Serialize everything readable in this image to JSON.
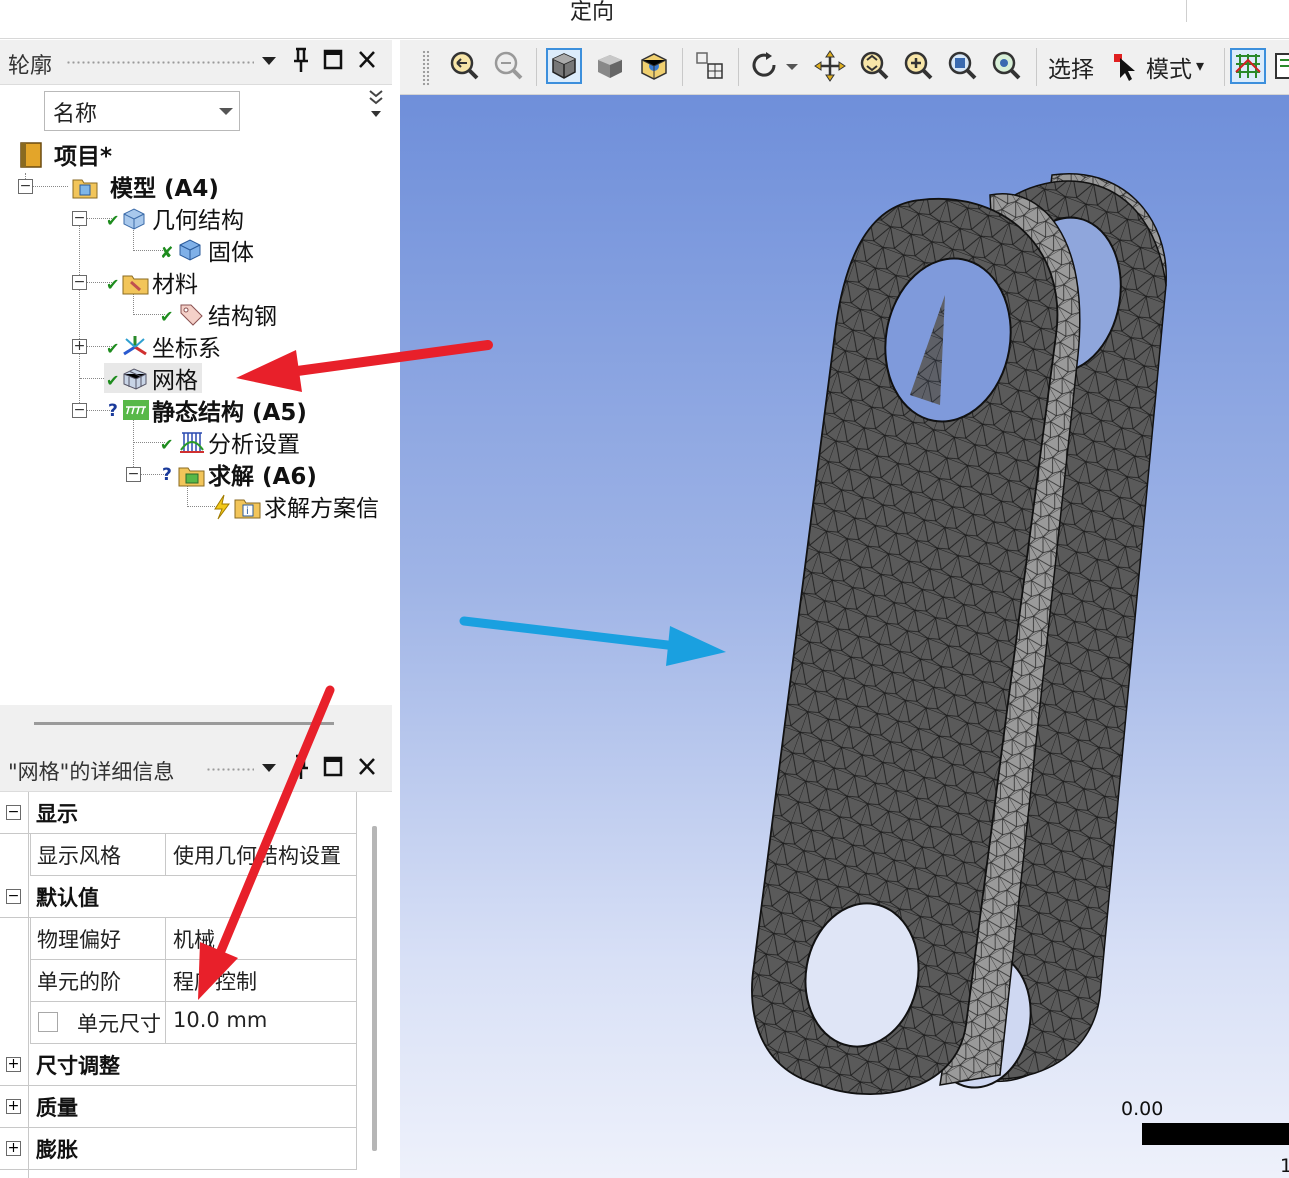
{
  "top_bar": {
    "label": "定向"
  },
  "outline": {
    "title": "轮廓",
    "filter_combo": "名称",
    "tree": {
      "project": "项目*",
      "model": "模型 (A4)",
      "geometry": "几何结构",
      "solid": "固体",
      "materials": "材料",
      "structural_steel": "结构钢",
      "coordinate_systems": "坐标系",
      "mesh": "网格",
      "static_structural": "静态结构 (A5)",
      "analysis_settings": "分析设置",
      "solution": "求解 (A6)",
      "solution_info": "求解方案信"
    }
  },
  "details": {
    "title": "\"网格\"的详细信息",
    "groups": {
      "display": "显示",
      "defaults": "默认值",
      "sizing": "尺寸调整",
      "quality": "质量",
      "inflation": "膨胀"
    },
    "props": {
      "display_style": {
        "name": "显示风格",
        "value": "使用几何结构设置"
      },
      "physics_preference": {
        "name": "物理偏好",
        "value": "机械"
      },
      "element_order": {
        "name": "单元的阶",
        "value": "程序控制"
      },
      "element_size": {
        "name": "单元尺寸",
        "value": "10.0 mm"
      }
    }
  },
  "toolbar": {
    "select_label": "选择",
    "mode_label": "模式",
    "mode_arrow": "▾"
  },
  "viewport": {
    "scale_label": "0.00",
    "scale_end_label": "1"
  },
  "colors": {
    "viewport_top": "#6f8fda",
    "viewport_bottom": "#eef1fb",
    "annotation_red": "#e8202a",
    "annotation_blue": "#1aa0e0",
    "mesh_face": "#4a4a4a"
  },
  "icons": [
    "pin-icon",
    "maximize-icon",
    "close-icon",
    "zoom-fit-icon",
    "zoom-box-icon",
    "solid-view-icon",
    "shaded-icon",
    "view-cube-icon",
    "rotate-icon",
    "pan-icon",
    "zoom-in-icon",
    "zoom-out-icon",
    "zoom-window-icon",
    "magnifier-icon",
    "select-pointer-icon",
    "mesh-toggle-icon"
  ]
}
